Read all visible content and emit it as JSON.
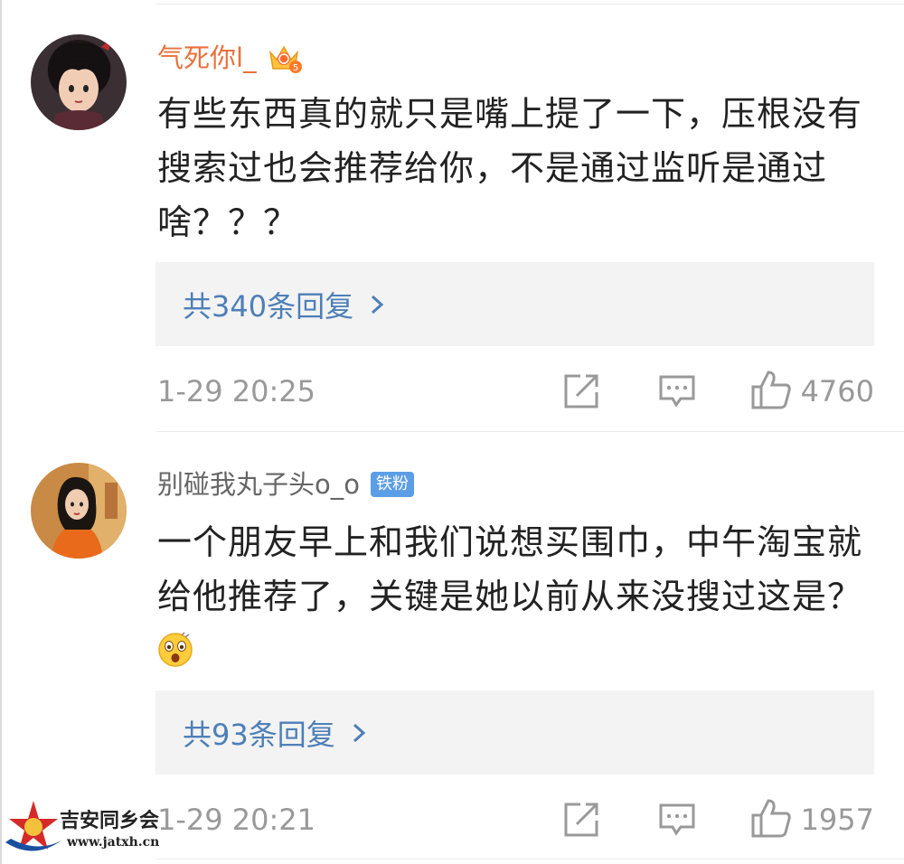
{
  "comments": [
    {
      "username": "气死你l_",
      "badge": "crown-vip-icon",
      "text": "有些东西真的就只是嘴上提了一下，压根没有搜索过也会推荐给你，不是通过监听是通过啥？？？",
      "reply_label": "共340条回复",
      "timestamp": "1-29 20:25",
      "likes": "4760"
    },
    {
      "username": "别碰我丸子头o_o",
      "badge_text": "铁粉",
      "text": "一个朋友早上和我们说想买围巾，中午淘宝就给他推荐了，关键是她以前从来没搜过这是？",
      "emoji": "astonished-face-icon",
      "reply_label": "共93条回复",
      "timestamp": "1-29 20:21",
      "likes": "1957"
    }
  ],
  "watermark": {
    "title": "吉安同乡会",
    "url": "www.jatxh.cn"
  },
  "colors": {
    "username_orange": "#e8713c",
    "username_gray": "#666666",
    "link_blue": "#4d7fb8",
    "meta_gray": "#999999",
    "reply_bg": "#f3f3f3"
  }
}
